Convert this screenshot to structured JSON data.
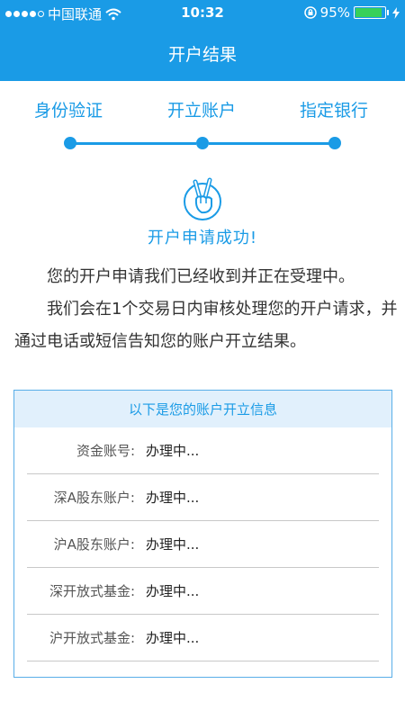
{
  "status_bar": {
    "carrier": "中国联通",
    "time": "10:32",
    "battery_percent_label": "95%",
    "battery_level": 0.95,
    "signal_bars_filled": 4,
    "signal_bars_total": 5
  },
  "nav": {
    "title": "开户结果"
  },
  "steps": {
    "items": [
      {
        "label": "身份验证"
      },
      {
        "label": "开立账户"
      },
      {
        "label": "指定银行"
      }
    ]
  },
  "result": {
    "icon": "victory-hand-icon",
    "title": "开户申请成功!",
    "paragraph1": "您的开户申请我们已经收到并正在受理中。",
    "paragraph2": "我们会在1个交易日内审核处理您的开户请求，并通过电话或短信告知您的账户开立结果。"
  },
  "info": {
    "header": "以下是您的账户开立信息",
    "rows": [
      {
        "label": "资金账号:",
        "value": "办理中..."
      },
      {
        "label": "深A股东账户:",
        "value": "办理中..."
      },
      {
        "label": "沪A股东账户:",
        "value": "办理中..."
      },
      {
        "label": "深开放式基金:",
        "value": "办理中..."
      },
      {
        "label": "沪开放式基金:",
        "value": "办理中..."
      }
    ]
  },
  "colors": {
    "primary": "#1a9be6",
    "header_bg": "#e1f0fc",
    "battery_green": "#37d05a"
  }
}
